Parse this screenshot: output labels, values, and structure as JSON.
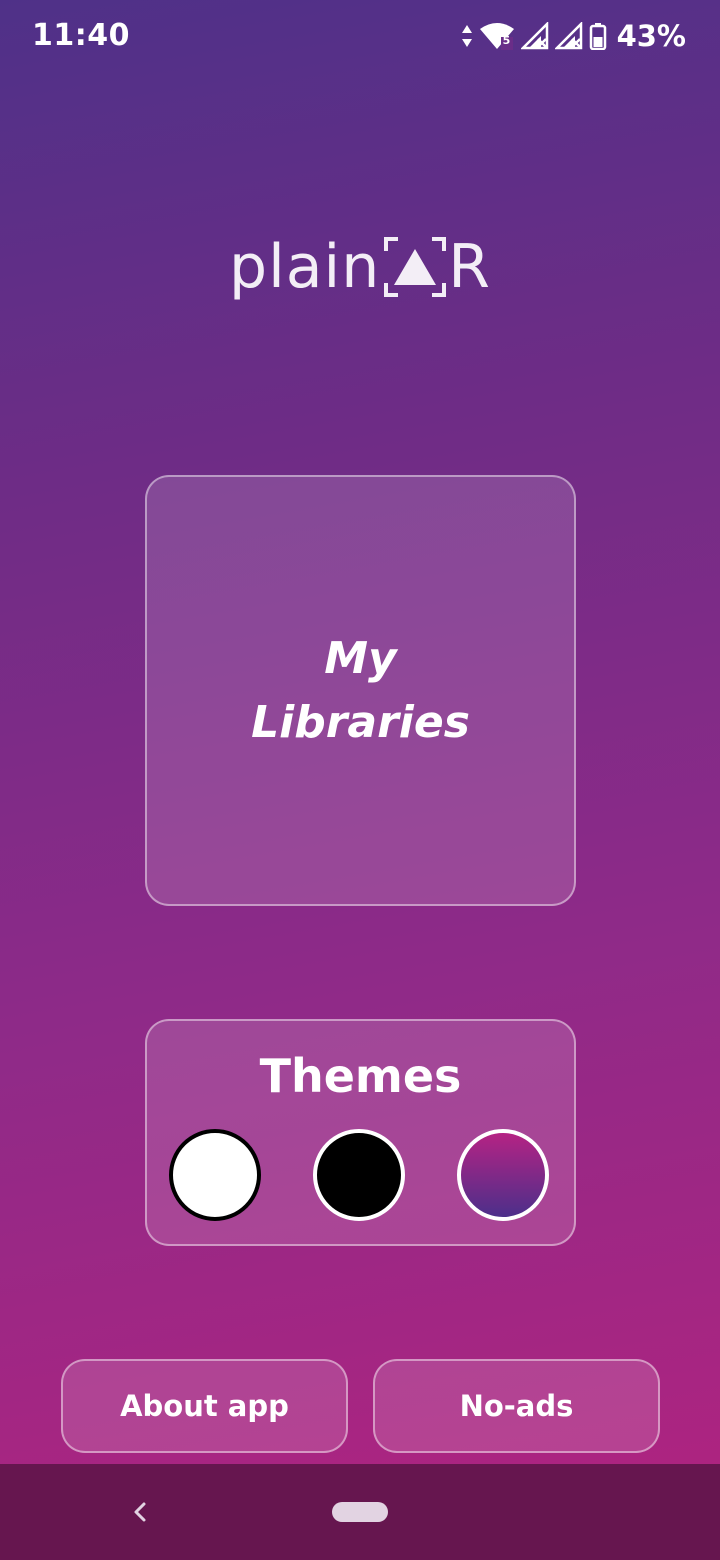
{
  "status_bar": {
    "time": "11:40",
    "battery_percent": "43%",
    "icons": [
      "data-arrows-icon",
      "wifi-icon",
      "signal-icon",
      "signal-icon",
      "battery-icon"
    ],
    "wifi_badge": "5"
  },
  "logo": {
    "text_before": "plain",
    "text_after": "R"
  },
  "libraries": {
    "label": "My Libraries"
  },
  "themes": {
    "title": "Themes",
    "options": [
      {
        "name": "white",
        "color": "#ffffff"
      },
      {
        "name": "black",
        "color": "#000000"
      },
      {
        "name": "gradient",
        "colors": [
          "#b52384",
          "#4c2f8a"
        ]
      }
    ]
  },
  "buttons": {
    "about": "About app",
    "no_ads": "No-ads"
  },
  "colors": {
    "background_top": "#4f3188",
    "background_bottom": "#b2237f",
    "nav_bar": "#66164f"
  }
}
